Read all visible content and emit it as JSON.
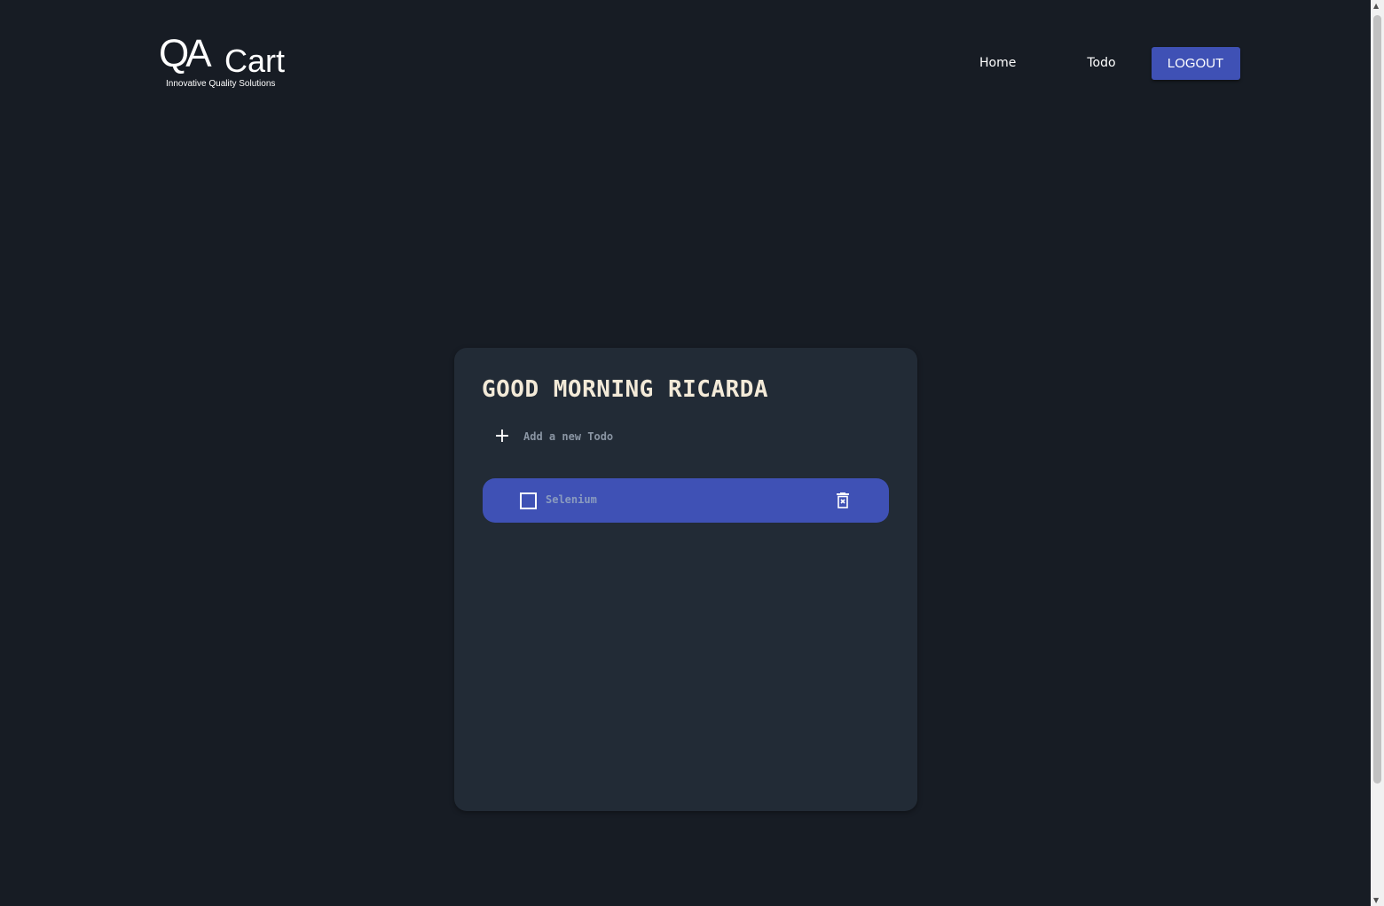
{
  "header": {
    "logo": {
      "mark": "QA",
      "name": "Cart",
      "tagline": "Innovative Quality Solutions"
    },
    "nav": {
      "home": "Home",
      "todo": "Todo",
      "logout": "LOGOUT"
    }
  },
  "card": {
    "greeting": "GOOD MORNING RICARDA",
    "add_placeholder": "Add a new Todo",
    "add_icon": "+",
    "todos": [
      {
        "label": "Selenium",
        "done": false
      }
    ]
  },
  "scrollbar": {
    "up": "▲",
    "down": "▼"
  }
}
